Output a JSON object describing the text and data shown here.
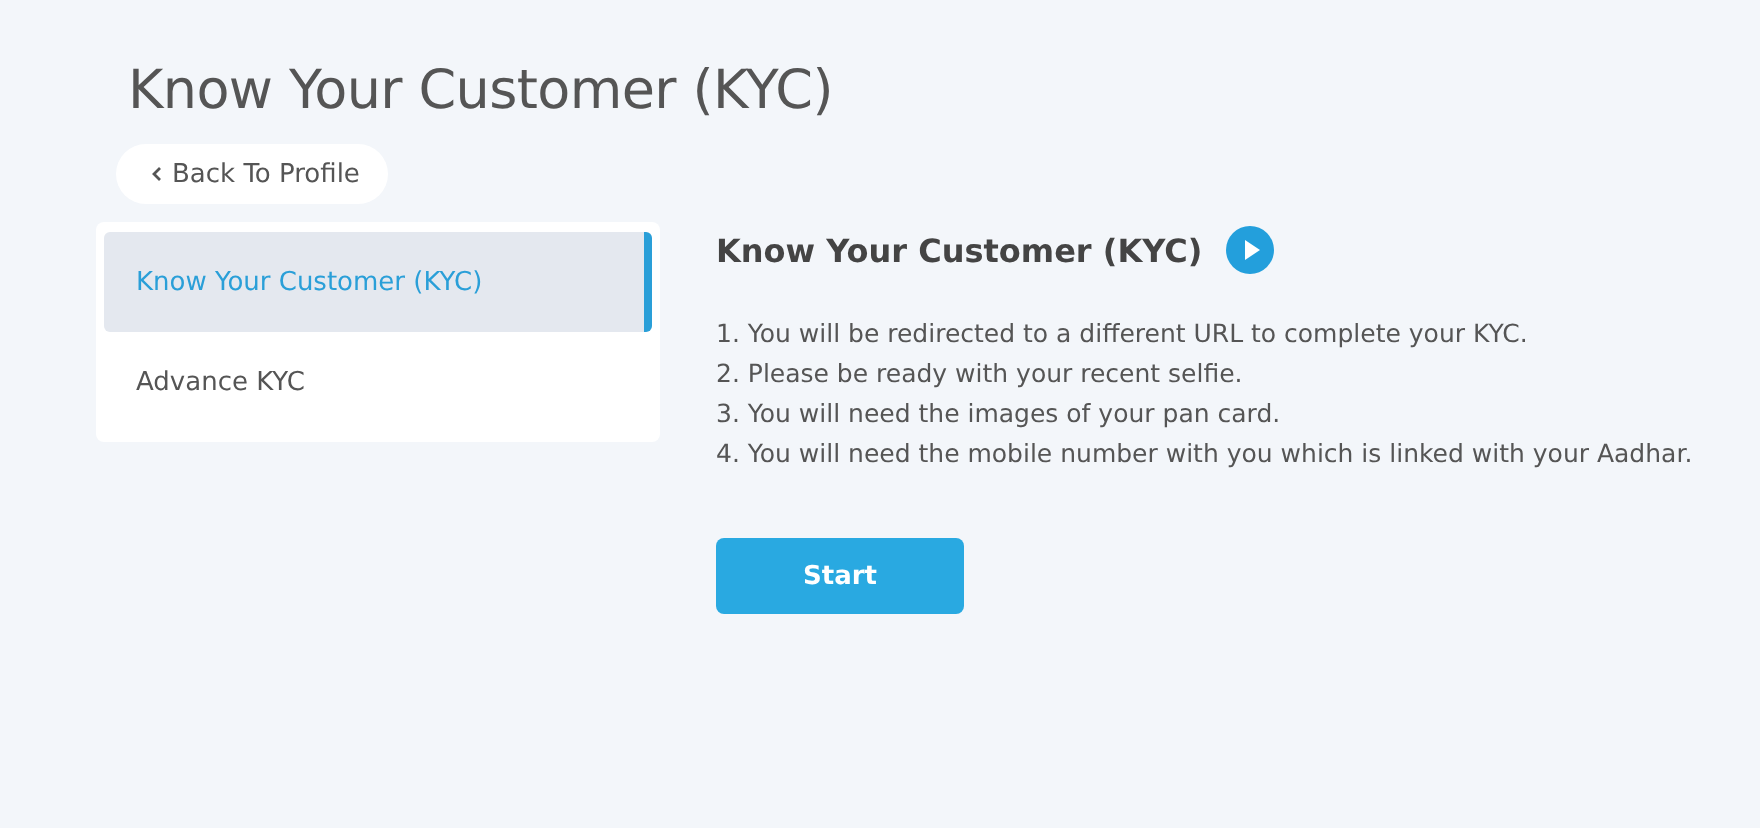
{
  "page_title": "Know Your Customer (KYC)",
  "back_button": {
    "label": "Back To Profile"
  },
  "sidebar": {
    "items": [
      {
        "label": "Know Your Customer (KYC)",
        "selected": true
      },
      {
        "label": "Advance KYC",
        "selected": false
      }
    ]
  },
  "content": {
    "heading": "Know Your Customer (KYC)",
    "instructions": [
      "1. You will be redirected to a different URL to complete your KYC.",
      "2. Please be ready with your recent selfie.",
      "3. You will need the images of your pan card.",
      "4. You will need the mobile number with you which is linked with your Aadhar."
    ],
    "button": "Start"
  }
}
